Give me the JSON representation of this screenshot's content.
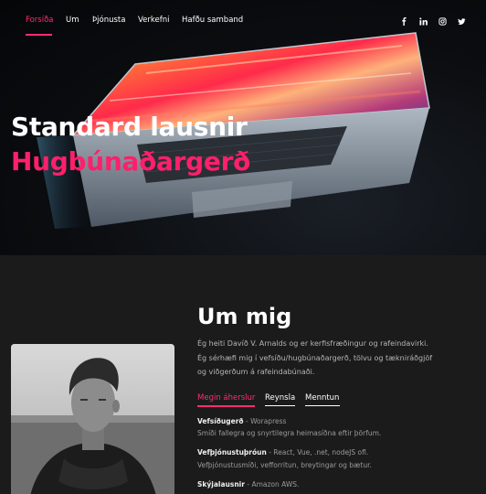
{
  "nav": {
    "items": [
      {
        "label": "Forsíða",
        "active": true
      },
      {
        "label": "Um"
      },
      {
        "label": "Þjónusta"
      },
      {
        "label": "Verkefni"
      },
      {
        "label": "Hafðu samband"
      }
    ],
    "social": [
      "facebook-icon",
      "linkedin-icon",
      "instagram-icon",
      "twitter-icon"
    ]
  },
  "hero": {
    "title": "Standard lausnir",
    "subtitle": "Hugbúnaðargerð"
  },
  "about": {
    "title": "Um mig",
    "text": "Ég heiti Davíð V. Arnalds og er kerfisfræðingur og rafeindavirki. Ég sérhæfi mig í vefsíðu/hugbúnaðargerð, tölvu og tækniráðgjöf og viðgerðum á rafeindabúnaði.",
    "tabs": [
      {
        "label": "Megin áherslur",
        "active": true
      },
      {
        "label": "Reynsla"
      },
      {
        "label": "Menntun"
      }
    ],
    "items": [
      {
        "title": "Vefsíðugerð",
        "sep": " - ",
        "tech": "Worapress",
        "desc": "Smíði fallegra og snyrtilegra heimasíðna eftir þörfum."
      },
      {
        "title": "Vefþjónustuþróun",
        "sep": " - ",
        "tech": "React, Vue, .net, nodeJS ofl.",
        "desc": "Vefþjónustusmíði, vefforritun, breytingar og bætur."
      },
      {
        "title": "Skýjalausnir",
        "sep": " - ",
        "tech": "Amazon AWS.",
        "desc": ""
      }
    ]
  },
  "colors": {
    "accent": "#ff2d6f",
    "background": "#1b1b1b"
  }
}
